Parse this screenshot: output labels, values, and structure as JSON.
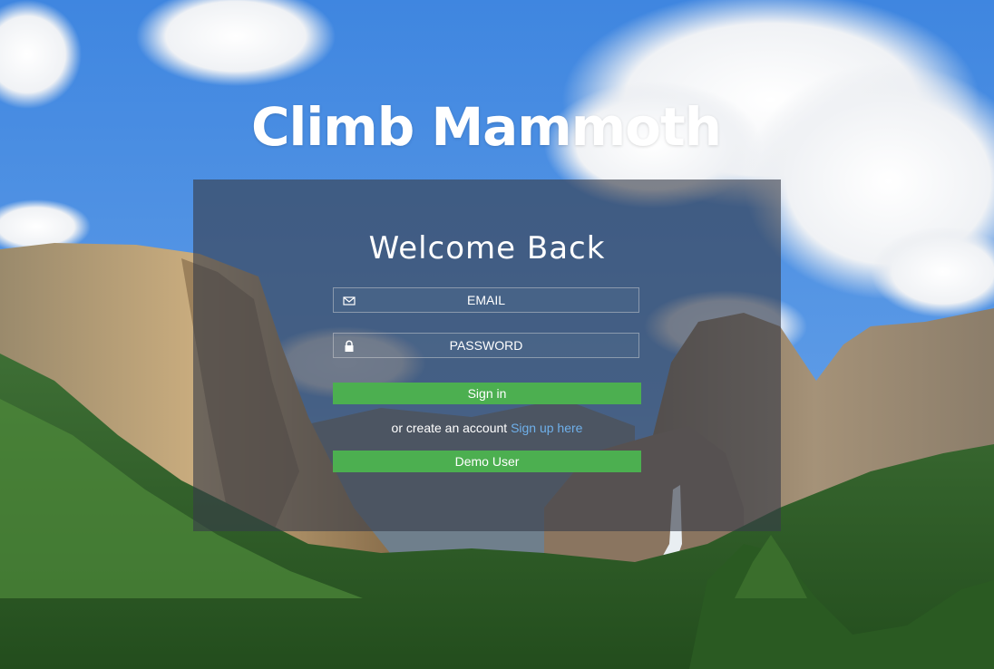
{
  "app": {
    "title": "Climb Mammoth"
  },
  "login": {
    "heading": "Welcome Back",
    "email_placeholder": "EMAIL",
    "password_placeholder": "PASSWORD",
    "signin_label": "Sign in",
    "alt_prefix": "or create an account",
    "signup_link": "Sign up here",
    "demo_label": "Demo User"
  },
  "icons": {
    "email": "envelope-icon",
    "password": "lock-icon"
  },
  "colors": {
    "button": "#4caf50",
    "link": "#6fb0ea",
    "panel": "#373c48"
  }
}
